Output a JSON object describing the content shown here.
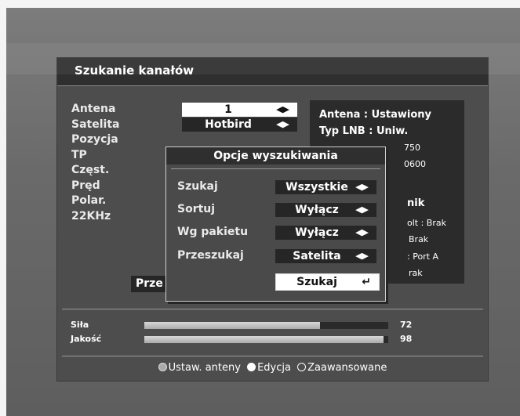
{
  "window": {
    "title": "Szukanie kanałów"
  },
  "fields": [
    {
      "label": "Antena",
      "value": "1",
      "selected": true
    },
    {
      "label": "Satelita",
      "value": "Hotbird",
      "selected": false
    },
    {
      "label": "Pozycja"
    },
    {
      "label": "TP"
    },
    {
      "label": "Częst."
    },
    {
      "label": "Pręd"
    },
    {
      "label": "Polar."
    },
    {
      "label": "22KHz"
    }
  ],
  "info_panel": {
    "antenna": "Antena : Ustawiony",
    "lnb_type": "Typ LNB : Uniw.",
    "line3": "750",
    "line4": "0600",
    "line5": "nik",
    "line6": "olt : Brak",
    "line7": "Brak",
    "line8": ": Port A",
    "line9": "rak"
  },
  "hidden_button_label": "Prze",
  "popup": {
    "title": "Opcje wyszukiwania",
    "options": [
      {
        "label": "Szukaj",
        "value": "Wszystkie"
      },
      {
        "label": "Sortuj",
        "value": "Wyłącz"
      },
      {
        "label": "Wg pakietu",
        "value": "Wyłącz"
      },
      {
        "label": "Przeszukaj",
        "value": "Satelita"
      }
    ],
    "search_button": "Szukaj",
    "enter_icon": "↵"
  },
  "signal": {
    "strength_label": "Siła",
    "strength_value": "72",
    "strength_fraction": 0.72,
    "quality_label": "Jakość",
    "quality_value": "98",
    "quality_fraction": 0.98
  },
  "legend": {
    "item1": "Ustaw. anteny",
    "item2": "Edycja",
    "item3": "Zaawansowane"
  },
  "icons": {
    "arrow": "◀▶",
    "dot_grey": "grey-circle-icon",
    "dot_white": "white-circle-icon",
    "dot_hollow": "hollow-circle-icon"
  }
}
